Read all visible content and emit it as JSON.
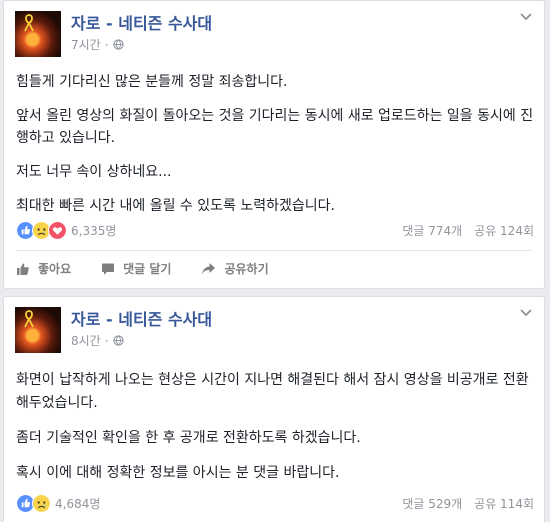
{
  "posts": [
    {
      "author": "자로 - 네티즌 수사대",
      "time": "7시간",
      "paragraphs": [
        "힘들게 기다리신 많은 분들께 정말 죄송합니다.",
        "앞서 올린 영상의 화질이 돌아오는 것을 기다리는 동시에 새로 업로드하는 일을 동시에 진행하고 있습니다.",
        "저도 너무 속이 상하네요...",
        "최대한 빠른 시간 내에 올릴 수 있도록 노력하겠습니다."
      ],
      "reactions_count": "6,335명",
      "comments": "댓글 774개",
      "shares": "공유 124회",
      "actions": {
        "like": "좋아요",
        "comment": "댓글 달기",
        "share": "공유하기"
      }
    },
    {
      "author": "자로 - 네티즌 수사대",
      "time": "8시간",
      "paragraphs": [
        "화면이 납작하게 나오는 현상은 시간이 지나면 해결된다 해서 잠시 영상을 비공개로 전환해두었습니다.",
        "좀더 기술적인 확인을 한 후 공개로 전환하도록 하겠습니다.",
        "혹시 이에 대해 정확한 정보를 아시는 분 댓글 바랍니다."
      ],
      "reactions_count": "4,684명",
      "comments": "댓글 529개",
      "shares": "공유 114회"
    }
  ],
  "colors": {
    "author": "#365899",
    "meta": "#90949c",
    "like": "#5890ff",
    "love": "#f25268",
    "sad": "#f7d44c"
  }
}
